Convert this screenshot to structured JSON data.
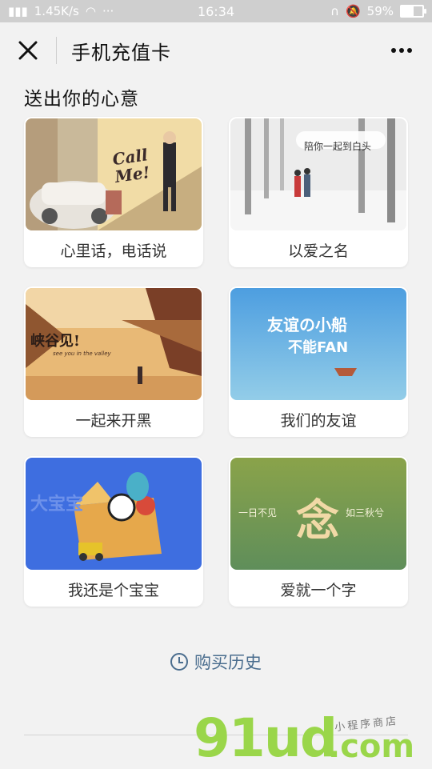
{
  "status_bar": {
    "network": "1.45K/s",
    "time": "16:34",
    "battery": "59%",
    "battery_level": 0.59
  },
  "header": {
    "title": "手机充值卡"
  },
  "section": {
    "title": "送出你的心意"
  },
  "cards": [
    {
      "label": "心里话，电话说",
      "art_text": "Call Me!"
    },
    {
      "label": "以爱之名",
      "art_text": "陪你一起到白头"
    },
    {
      "label": "一起来开黑",
      "art_text": "峡谷见!",
      "art_subtext": "see you in the valley"
    },
    {
      "label": "我们的友谊",
      "art_text": "友谊の小船",
      "art_text2": "不能FAN"
    },
    {
      "label": "我还是个宝宝",
      "art_text": "大宝宝"
    },
    {
      "label": "爱就一个字",
      "art_text": "念",
      "art_left": "一日不见",
      "art_right": "如三秋兮"
    }
  ],
  "footer": {
    "history_label": "购买历史"
  },
  "watermark": {
    "main": "91ud",
    "domain": ".com",
    "small": "小程序商店"
  },
  "colors": {
    "background": "#f2f2f2",
    "link": "#4a6d8e",
    "watermark": "#9ad64a"
  }
}
